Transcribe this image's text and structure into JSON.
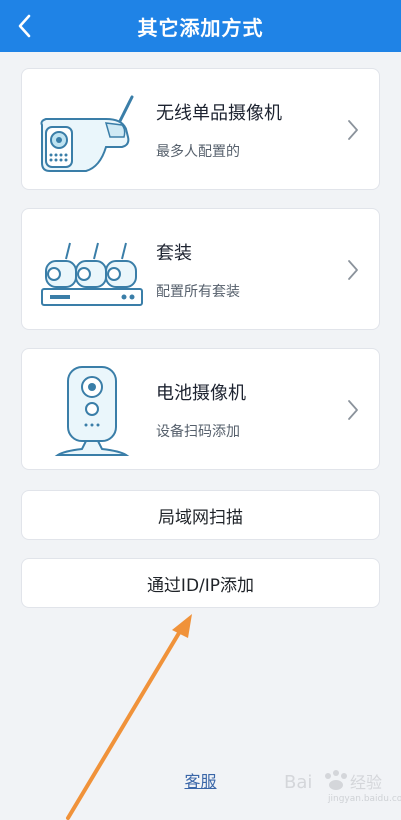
{
  "header": {
    "title": "其它添加方式",
    "back_icon": "chevron-left-icon"
  },
  "options": [
    {
      "title": "无线单品摄像机",
      "subtitle": "最多人配置的",
      "icon": "wireless-camera-icon"
    },
    {
      "title": "套装",
      "subtitle": "配置所有套装",
      "icon": "nvr-kit-icon"
    },
    {
      "title": "电池摄像机",
      "subtitle": "设备扫码添加",
      "icon": "battery-camera-icon"
    }
  ],
  "buttons": {
    "lan_scan": "局域网扫描",
    "add_by_id_ip": "通过ID/IP添加"
  },
  "footer": {
    "customer_service": "客服"
  },
  "watermark": {
    "text": "Bai经验",
    "subtext": "jingyan.baidu.com"
  },
  "colors": {
    "header_bg": "#1f83e6",
    "page_bg": "#f1f3f6",
    "annotation_arrow": "#f0923a"
  }
}
